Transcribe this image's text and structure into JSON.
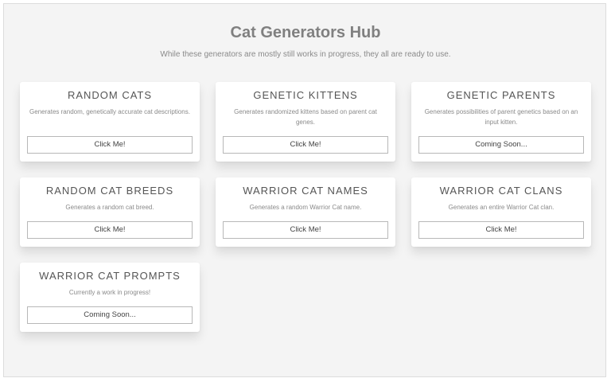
{
  "header": {
    "title": "Cat Generators Hub",
    "subtitle": "While these generators are mostly still works in progress, they all are ready to use."
  },
  "cards": [
    {
      "title": "RANDOM CATS",
      "description": "Generates random, genetically accurate cat descriptions.",
      "button": "Click Me!"
    },
    {
      "title": "GENETIC KITTENS",
      "description": "Generates randomized kittens based on parent cat genes.",
      "button": "Click Me!"
    },
    {
      "title": "GENETIC PARENTS",
      "description": "Generates possibilities of parent genetics based on an input kitten.",
      "button": "Coming Soon..."
    },
    {
      "title": "RANDOM CAT BREEDS",
      "description": "Generates a random cat breed.",
      "button": "Click Me!"
    },
    {
      "title": "WARRIOR CAT NAMES",
      "description": "Generates a random Warrior Cat name.",
      "button": "Click Me!"
    },
    {
      "title": "WARRIOR CAT CLANS",
      "description": "Generates an entire Warrior Cat clan.",
      "button": "Click Me!"
    },
    {
      "title": "WARRIOR CAT PROMPTS",
      "description": "Currently a work in progress!",
      "button": "Coming Soon..."
    }
  ]
}
